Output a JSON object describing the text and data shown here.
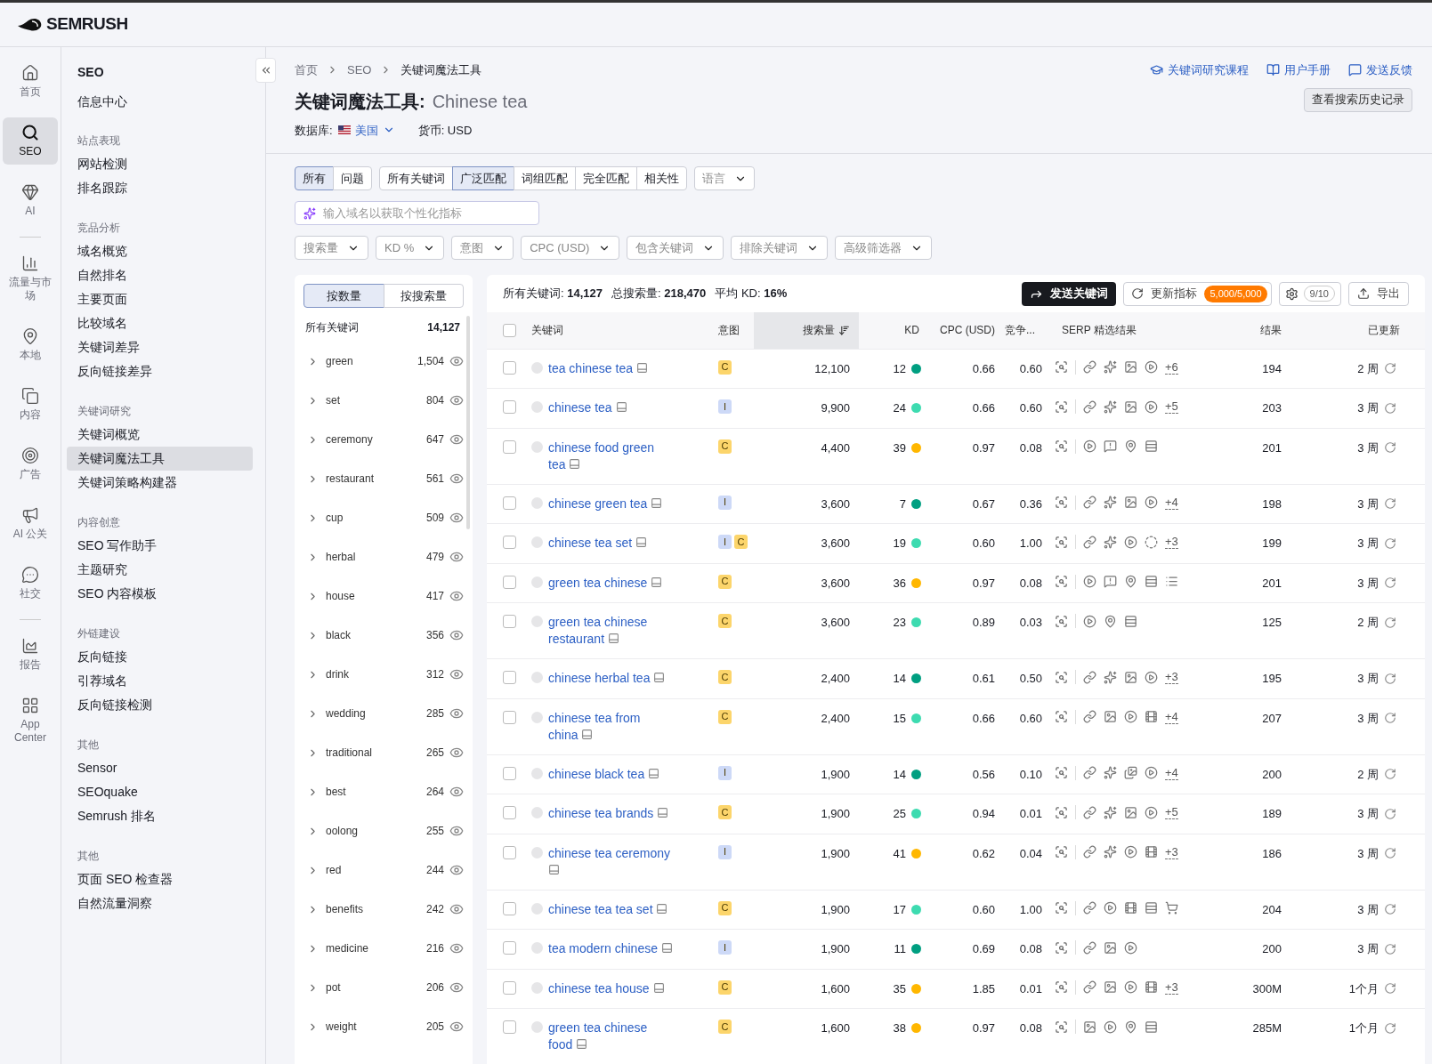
{
  "brand": "SEMRUSH",
  "rail": [
    {
      "kind": "home",
      "label": "首页",
      "selected": false
    },
    {
      "kind": "seo",
      "label": "SEO",
      "selected": true
    },
    {
      "kind": "ai",
      "label": "AI",
      "selected": false
    },
    {
      "kind": "traffic",
      "label": "流量与市场",
      "selected": false
    },
    {
      "kind": "local",
      "label": "本地",
      "selected": false
    },
    {
      "kind": "content",
      "label": "内容",
      "selected": false
    },
    {
      "kind": "ads",
      "label": "广告",
      "selected": false
    },
    {
      "kind": "pr",
      "label": "AI 公关",
      "selected": false
    },
    {
      "kind": "social",
      "label": "社交",
      "selected": false
    },
    {
      "kind": "reports",
      "label": "报告",
      "selected": false
    },
    {
      "kind": "apps",
      "label": "App Center",
      "selected": false
    }
  ],
  "nav": {
    "title": "SEO",
    "top_items": [
      {
        "label": "信息中心",
        "selected": false
      }
    ],
    "sections": [
      {
        "heading": "站点表现",
        "items": [
          {
            "label": "网站检测",
            "selected": false
          },
          {
            "label": "排名跟踪",
            "selected": false
          }
        ]
      },
      {
        "heading": "竞品分析",
        "items": [
          {
            "label": "域名概览",
            "selected": false
          },
          {
            "label": "自然排名",
            "selected": false
          },
          {
            "label": "主要页面",
            "selected": false
          },
          {
            "label": "比较域名",
            "selected": false
          },
          {
            "label": "关键词差异",
            "selected": false
          },
          {
            "label": "反向链接差异",
            "selected": false
          }
        ]
      },
      {
        "heading": "关键词研究",
        "items": [
          {
            "label": "关键词概览",
            "selected": false
          },
          {
            "label": "关键词魔法工具",
            "selected": true
          },
          {
            "label": "关键词策略构建器",
            "selected": false
          }
        ]
      },
      {
        "heading": "内容创意",
        "items": [
          {
            "label": "SEO 写作助手",
            "selected": false
          },
          {
            "label": "主题研究",
            "selected": false
          },
          {
            "label": "SEO 内容模板",
            "selected": false
          }
        ]
      },
      {
        "heading": "外链建设",
        "items": [
          {
            "label": "反向链接",
            "selected": false
          },
          {
            "label": "引荐域名",
            "selected": false
          },
          {
            "label": "反向链接检测",
            "selected": false
          }
        ]
      },
      {
        "heading": "其他",
        "items": [
          {
            "label": "Sensor",
            "selected": false
          },
          {
            "label": "SEOquake",
            "selected": false
          },
          {
            "label": "Semrush 排名",
            "selected": false
          }
        ]
      },
      {
        "heading": "其他",
        "items": [
          {
            "label": "页面 SEO 检查器",
            "selected": false
          },
          {
            "label": "自然流量洞察",
            "selected": false
          }
        ]
      }
    ]
  },
  "breadcrumb": [
    "首页",
    "SEO",
    "关键词魔法工具"
  ],
  "title": "关键词魔法工具:",
  "query": "Chinese tea",
  "database_label": "数据库:",
  "database": "美国",
  "currency": "货币: USD",
  "header_links": [
    {
      "kind": "course",
      "label": "关键词研究课程"
    },
    {
      "kind": "manual",
      "label": "用户手册"
    },
    {
      "kind": "feedback",
      "label": "发送反馈"
    }
  ],
  "history_button": "查看搜索历史记录",
  "question_tabs": [
    {
      "label": "所有",
      "selected": true
    },
    {
      "label": "问题",
      "selected": false
    }
  ],
  "match_tabs": [
    {
      "label": "所有关键词",
      "selected": false
    },
    {
      "label": "广泛匹配",
      "selected": true
    },
    {
      "label": "词组匹配",
      "selected": false
    },
    {
      "label": "完全匹配",
      "selected": false
    },
    {
      "label": "相关性",
      "selected": false
    }
  ],
  "language_dropdown": "语言",
  "domain_input": {
    "placeholder": "输入域名以获取个性化指标"
  },
  "filters": [
    "搜索量",
    "KD %",
    "意图",
    "CPC (USD)",
    "包含关键词",
    "排除关键词",
    "高级筛选器"
  ],
  "group_tabs": [
    {
      "label": "按数量",
      "selected": true
    },
    {
      "label": "按搜索量",
      "selected": false
    }
  ],
  "groups_total": {
    "label": "所有关键词",
    "count": "14,127"
  },
  "groups": [
    {
      "label": "green",
      "count": "1,504"
    },
    {
      "label": "set",
      "count": "804"
    },
    {
      "label": "ceremony",
      "count": "647"
    },
    {
      "label": "restaurant",
      "count": "561"
    },
    {
      "label": "cup",
      "count": "509"
    },
    {
      "label": "herbal",
      "count": "479"
    },
    {
      "label": "house",
      "count": "417"
    },
    {
      "label": "black",
      "count": "356"
    },
    {
      "label": "drink",
      "count": "312"
    },
    {
      "label": "wedding",
      "count": "285"
    },
    {
      "label": "traditional",
      "count": "265"
    },
    {
      "label": "best",
      "count": "264"
    },
    {
      "label": "oolong",
      "count": "255"
    },
    {
      "label": "red",
      "count": "244"
    },
    {
      "label": "benefits",
      "count": "242"
    },
    {
      "label": "medicine",
      "count": "216"
    },
    {
      "label": "pot",
      "count": "206"
    },
    {
      "label": "weight",
      "count": "205"
    }
  ],
  "summary": [
    {
      "label": "所有关键词:",
      "value": "14,127"
    },
    {
      "label": "总搜索量:",
      "value": "218,470"
    },
    {
      "label": "平均 KD:",
      "value": "16%"
    }
  ],
  "send_button": "发送关键词",
  "update_button": {
    "label": "更新指标",
    "badge": "5,000/5,000"
  },
  "settings_count": "9/10",
  "export_button": "导出",
  "table": {
    "select_all_checked": false,
    "columns": [
      {
        "label": "关键词",
        "sorted": false
      },
      {
        "label": "意图",
        "sorted": false
      },
      {
        "label": "搜索量",
        "sorted": true
      },
      {
        "label": "KD",
        "sorted": false
      },
      {
        "label": "CPC (USD)",
        "sorted": false
      },
      {
        "label": "竞争...",
        "sorted": false
      },
      {
        "label": "SERP 精选结果",
        "sorted": false
      },
      {
        "label": "结果",
        "sorted": false
      },
      {
        "label": "已更新",
        "sorted": false
      }
    ],
    "rows": [
      {
        "checked": false,
        "keyword": "tea chinese tea",
        "intent": [
          {
            "label": "C",
            "color": "#fcd56b"
          }
        ],
        "volume": "12,100",
        "kd": {
          "value": "12",
          "color": "#009f81"
        },
        "cpc": "0.66",
        "competition": "0.60",
        "serp": [
          {
            "kind": "link"
          },
          {
            "kind": "ai"
          },
          {
            "kind": "image"
          },
          {
            "kind": "video"
          }
        ],
        "serp_more": "+6",
        "results": "194",
        "updated": "2 周"
      },
      {
        "checked": false,
        "keyword": "chinese tea",
        "intent": [
          {
            "label": "I",
            "color": "#cdd9f7"
          }
        ],
        "volume": "9,900",
        "kd": {
          "value": "24",
          "color": "#3ddbb0"
        },
        "cpc": "0.66",
        "competition": "0.60",
        "serp": [
          {
            "kind": "link"
          },
          {
            "kind": "ai"
          },
          {
            "kind": "image"
          },
          {
            "kind": "video"
          }
        ],
        "serp_more": "+5",
        "results": "203",
        "updated": "3 周"
      },
      {
        "checked": false,
        "keyword": "chinese food green tea",
        "intent": [
          {
            "label": "C",
            "color": "#fcd56b"
          }
        ],
        "volume": "4,400",
        "kd": {
          "value": "39",
          "color": "#ffb700"
        },
        "cpc": "0.97",
        "competition": "0.08",
        "serp": [
          {
            "kind": "video"
          },
          {
            "kind": "review"
          },
          {
            "kind": "location"
          },
          {
            "kind": "table"
          }
        ],
        "results": "201",
        "updated": "3 周"
      },
      {
        "checked": false,
        "keyword": "chinese green tea",
        "intent": [
          {
            "label": "I",
            "color": "#cdd9f7"
          }
        ],
        "volume": "3,600",
        "kd": {
          "value": "7",
          "color": "#009f81"
        },
        "cpc": "0.67",
        "competition": "0.36",
        "serp": [
          {
            "kind": "link"
          },
          {
            "kind": "ai"
          },
          {
            "kind": "image"
          },
          {
            "kind": "video"
          }
        ],
        "serp_more": "+4",
        "results": "198",
        "updated": "3 周"
      },
      {
        "checked": false,
        "keyword": "chinese tea set",
        "intent": [
          {
            "label": "I",
            "color": "#cdd9f7"
          },
          {
            "label": "C",
            "color": "#fcd56b"
          }
        ],
        "volume": "3,600",
        "kd": {
          "value": "19",
          "color": "#3ddbb0"
        },
        "cpc": "0.60",
        "competition": "1.00",
        "serp": [
          {
            "kind": "link"
          },
          {
            "kind": "ai"
          },
          {
            "kind": "video"
          },
          {
            "kind": "video-dashed"
          }
        ],
        "serp_more": "+3",
        "results": "199",
        "updated": "3 周"
      },
      {
        "checked": false,
        "keyword": "green tea chinese",
        "intent": [
          {
            "label": "C",
            "color": "#fcd56b"
          }
        ],
        "volume": "3,600",
        "kd": {
          "value": "36",
          "color": "#ffb700"
        },
        "cpc": "0.97",
        "competition": "0.08",
        "serp": [
          {
            "kind": "video"
          },
          {
            "kind": "review"
          },
          {
            "kind": "location"
          },
          {
            "kind": "table"
          },
          {
            "kind": "list"
          }
        ],
        "results": "201",
        "updated": "3 周"
      },
      {
        "checked": false,
        "keyword": "green tea chinese restaurant",
        "intent": [
          {
            "label": "C",
            "color": "#fcd56b"
          }
        ],
        "volume": "3,600",
        "kd": {
          "value": "23",
          "color": "#3ddbb0"
        },
        "cpc": "0.89",
        "competition": "0.03",
        "serp": [
          {
            "kind": "video"
          },
          {
            "kind": "location"
          },
          {
            "kind": "table"
          }
        ],
        "results": "125",
        "updated": "2 周"
      },
      {
        "checked": false,
        "keyword": "chinese herbal tea",
        "intent": [
          {
            "label": "C",
            "color": "#fcd56b"
          }
        ],
        "volume": "2,400",
        "kd": {
          "value": "14",
          "color": "#009f81"
        },
        "cpc": "0.61",
        "competition": "0.50",
        "serp": [
          {
            "kind": "link"
          },
          {
            "kind": "ai"
          },
          {
            "kind": "image"
          },
          {
            "kind": "video"
          }
        ],
        "serp_more": "+3",
        "results": "195",
        "updated": "3 周"
      },
      {
        "checked": false,
        "keyword": "chinese tea from china",
        "intent": [
          {
            "label": "C",
            "color": "#fcd56b"
          }
        ],
        "volume": "2,400",
        "kd": {
          "value": "15",
          "color": "#3ddbb0"
        },
        "cpc": "0.66",
        "competition": "0.60",
        "serp": [
          {
            "kind": "link"
          },
          {
            "kind": "image"
          },
          {
            "kind": "video"
          },
          {
            "kind": "film"
          }
        ],
        "serp_more": "+4",
        "results": "207",
        "updated": "3 周"
      },
      {
        "checked": false,
        "keyword": "chinese black tea",
        "intent": [
          {
            "label": "I",
            "color": "#cdd9f7"
          }
        ],
        "volume": "1,900",
        "kd": {
          "value": "14",
          "color": "#009f81"
        },
        "cpc": "0.56",
        "competition": "0.10",
        "serp": [
          {
            "kind": "link"
          },
          {
            "kind": "ai"
          },
          {
            "kind": "gallery"
          },
          {
            "kind": "video"
          }
        ],
        "serp_more": "+4",
        "results": "200",
        "updated": "2 周"
      },
      {
        "checked": false,
        "keyword": "chinese tea brands",
        "intent": [
          {
            "label": "C",
            "color": "#fcd56b"
          }
        ],
        "volume": "1,900",
        "kd": {
          "value": "25",
          "color": "#3ddbb0"
        },
        "cpc": "0.94",
        "competition": "0.01",
        "serp": [
          {
            "kind": "link"
          },
          {
            "kind": "ai"
          },
          {
            "kind": "image"
          },
          {
            "kind": "video"
          }
        ],
        "serp_more": "+5",
        "results": "189",
        "updated": "3 周"
      },
      {
        "checked": false,
        "keyword": "chinese tea ceremony",
        "intent": [
          {
            "label": "I",
            "color": "#cdd9f7"
          }
        ],
        "volume": "1,900",
        "kd": {
          "value": "41",
          "color": "#ffb700"
        },
        "cpc": "0.62",
        "competition": "0.04",
        "serp": [
          {
            "kind": "link"
          },
          {
            "kind": "ai"
          },
          {
            "kind": "video"
          },
          {
            "kind": "film"
          }
        ],
        "serp_more": "+3",
        "results": "186",
        "updated": "3 周"
      },
      {
        "checked": false,
        "keyword": "chinese tea tea set",
        "intent": [
          {
            "label": "C",
            "color": "#fcd56b"
          }
        ],
        "volume": "1,900",
        "kd": {
          "value": "17",
          "color": "#3ddbb0"
        },
        "cpc": "0.60",
        "competition": "1.00",
        "serp": [
          {
            "kind": "link"
          },
          {
            "kind": "video"
          },
          {
            "kind": "film"
          },
          {
            "kind": "table"
          },
          {
            "kind": "cart"
          }
        ],
        "results": "204",
        "updated": "3 周"
      },
      {
        "checked": false,
        "keyword": "tea modern chinese",
        "intent": [
          {
            "label": "I",
            "color": "#cdd9f7"
          }
        ],
        "volume": "1,900",
        "kd": {
          "value": "11",
          "color": "#009f81"
        },
        "cpc": "0.69",
        "competition": "0.08",
        "serp": [
          {
            "kind": "link"
          },
          {
            "kind": "image"
          },
          {
            "kind": "video"
          }
        ],
        "results": "200",
        "updated": "3 周"
      },
      {
        "checked": false,
        "keyword": "chinese tea house",
        "intent": [
          {
            "label": "C",
            "color": "#fcd56b"
          }
        ],
        "volume": "1,600",
        "kd": {
          "value": "35",
          "color": "#ffb700"
        },
        "cpc": "1.85",
        "competition": "0.01",
        "serp": [
          {
            "kind": "link"
          },
          {
            "kind": "image"
          },
          {
            "kind": "video"
          },
          {
            "kind": "film"
          }
        ],
        "serp_more": "+3",
        "results": "300M",
        "updated": "1个月"
      },
      {
        "checked": false,
        "keyword": "green tea chinese food",
        "intent": [
          {
            "label": "C",
            "color": "#fcd56b"
          }
        ],
        "volume": "1,600",
        "kd": {
          "value": "38",
          "color": "#ffb700"
        },
        "cpc": "0.97",
        "competition": "0.08",
        "serp": [
          {
            "kind": "image"
          },
          {
            "kind": "video"
          },
          {
            "kind": "location"
          },
          {
            "kind": "table"
          }
        ],
        "results": "285M",
        "updated": "1个月"
      }
    ]
  }
}
